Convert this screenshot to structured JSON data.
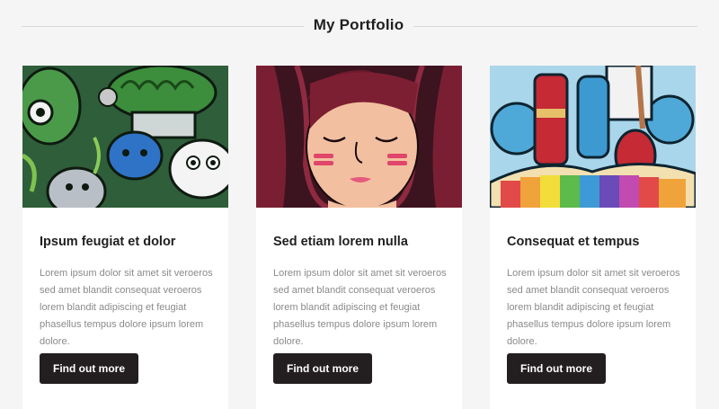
{
  "header": {
    "title": "My Portfolio"
  },
  "cards": [
    {
      "image": "doodle-creatures-illustration",
      "title": "Ipsum feugiat et dolor",
      "text": "Lorem ipsum dolor sit amet sit veroeros sed amet blandit consequat veroeros lorem blandit adipiscing et feugiat phasellus tempus dolore ipsum lorem dolore.",
      "button_label": "Find out more"
    },
    {
      "image": "girl-face-illustration",
      "title": "Sed etiam lorem nulla",
      "text": "Lorem ipsum dolor sit amet sit veroeros sed amet blandit consequat veroeros lorem blandit adipiscing et feugiat phasellus tempus dolore ipsum lorem dolore.",
      "button_label": "Find out more"
    },
    {
      "image": "paint-supplies-illustration",
      "title": "Consequat et tempus",
      "text": "Lorem ipsum dolor sit amet sit veroeros sed amet blandit consequat veroeros lorem blandit adipiscing et feugiat phasellus tempus dolore ipsum lorem dolore.",
      "button_label": "Find out more"
    }
  ]
}
